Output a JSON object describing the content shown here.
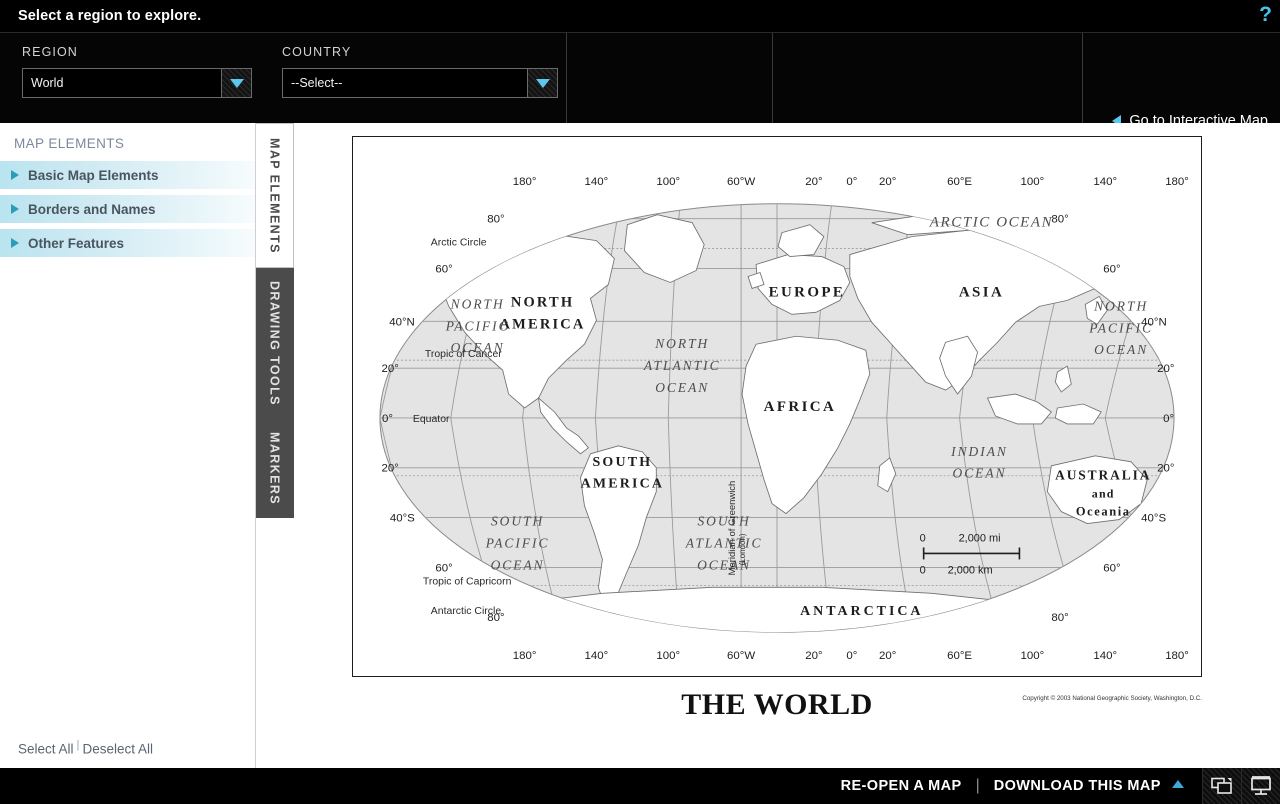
{
  "titlebar": {
    "title": "Select a region to explore.",
    "help_icon": "?"
  },
  "selectors": {
    "region": {
      "label": "REGION",
      "value": "World"
    },
    "country": {
      "label": "COUNTRY",
      "value": "--Select--"
    },
    "goto_interactive_map": "Go to Interactive Map"
  },
  "left_panel": {
    "title": "MAP ELEMENTS",
    "items": [
      {
        "label": "Basic Map Elements"
      },
      {
        "label": "Borders and Names"
      },
      {
        "label": "Other Features"
      }
    ],
    "select_all": "Select All",
    "deselect_all": "Deselect All",
    "separator": "|"
  },
  "vertical_tabs": [
    {
      "label": "MAP ELEMENTS",
      "active": true
    },
    {
      "label": "DRAWING TOOLS",
      "active": false
    },
    {
      "label": "MARKERS",
      "active": false
    }
  ],
  "map": {
    "title": "THE WORLD",
    "copyright": "Copyright © 2003 National Geographic Society, Washington, D.C.",
    "longitude_labels": [
      "180°",
      "140°",
      "100°",
      "60°W",
      "20°",
      "0°",
      "20°",
      "60°E",
      "100°",
      "140°",
      "180°"
    ],
    "latitude_labels_left": [
      "80°",
      "60°",
      "40°N",
      "20°",
      "0°",
      "20°",
      "40°S",
      "60°",
      "80°"
    ],
    "latitude_labels_right": [
      "80°",
      "60°",
      "40°N",
      "20°",
      "0°",
      "20°",
      "40°S",
      "60°",
      "80°"
    ],
    "reference_lines": [
      "Arctic Circle",
      "Tropic of Cancer",
      "Equator",
      "Tropic of Capricorn",
      "Antarctic Circle"
    ],
    "meridian_label": "Meridian of Greenwich",
    "meridian_sublabel": "(London)",
    "continents": [
      "NORTH AMERICA",
      "SOUTH AMERICA",
      "EUROPE",
      "AFRICA",
      "ASIA",
      "AUSTRALIA and Oceania",
      "ANTARCTICA"
    ],
    "continent_labels": {
      "north_america_l1": "NORTH",
      "north_america_l2": "AMERICA",
      "south_america_l1": "SOUTH",
      "south_america_l2": "AMERICA",
      "europe": "EUROPE",
      "africa": "AFRICA",
      "asia": "ASIA",
      "australia_l1": "AUSTRALIA",
      "australia_l2": "and",
      "australia_l3": "Oceania",
      "antarctica": "ANTARCTICA"
    },
    "oceans": {
      "arctic": "ARCTIC OCEAN",
      "north_pacific_w_l1": "NORTH",
      "north_pacific_w_l2": "PACIFIC",
      "north_pacific_w_l3": "OCEAN",
      "north_atlantic_l1": "NORTH",
      "north_atlantic_l2": "ATLANTIC",
      "north_atlantic_l3": "OCEAN",
      "north_pacific_e_l1": "NORTH",
      "north_pacific_e_l2": "PACIFIC",
      "north_pacific_e_l3": "OCEAN",
      "south_pacific_l1": "SOUTH",
      "south_pacific_l2": "PACIFIC",
      "south_pacific_l3": "OCEAN",
      "south_atlantic_l1": "SOUTH",
      "south_atlantic_l2": "ATLANTIC",
      "south_atlantic_l3": "OCEAN",
      "indian_l1": "INDIAN",
      "indian_l2": "OCEAN"
    },
    "scale_bar": {
      "miles_zero": "0",
      "miles_value": "2,000 mi",
      "km_zero": "0",
      "km_value": "2,000 km"
    }
  },
  "bottom_bar": {
    "reopen_map": "RE-OPEN A MAP",
    "separator": "|",
    "download_map": "DOWNLOAD THIS MAP",
    "icons": [
      "windows-icon",
      "presentation-screen-icon"
    ]
  },
  "colors": {
    "accent_blue": "#5cc8ef",
    "panel_title": "#7a8a9c",
    "row_gradient_start": "#b9e4ef",
    "ocean_fill": "#e3e3e3",
    "land_fill": "#ffffff",
    "bar_black": "#000000"
  }
}
